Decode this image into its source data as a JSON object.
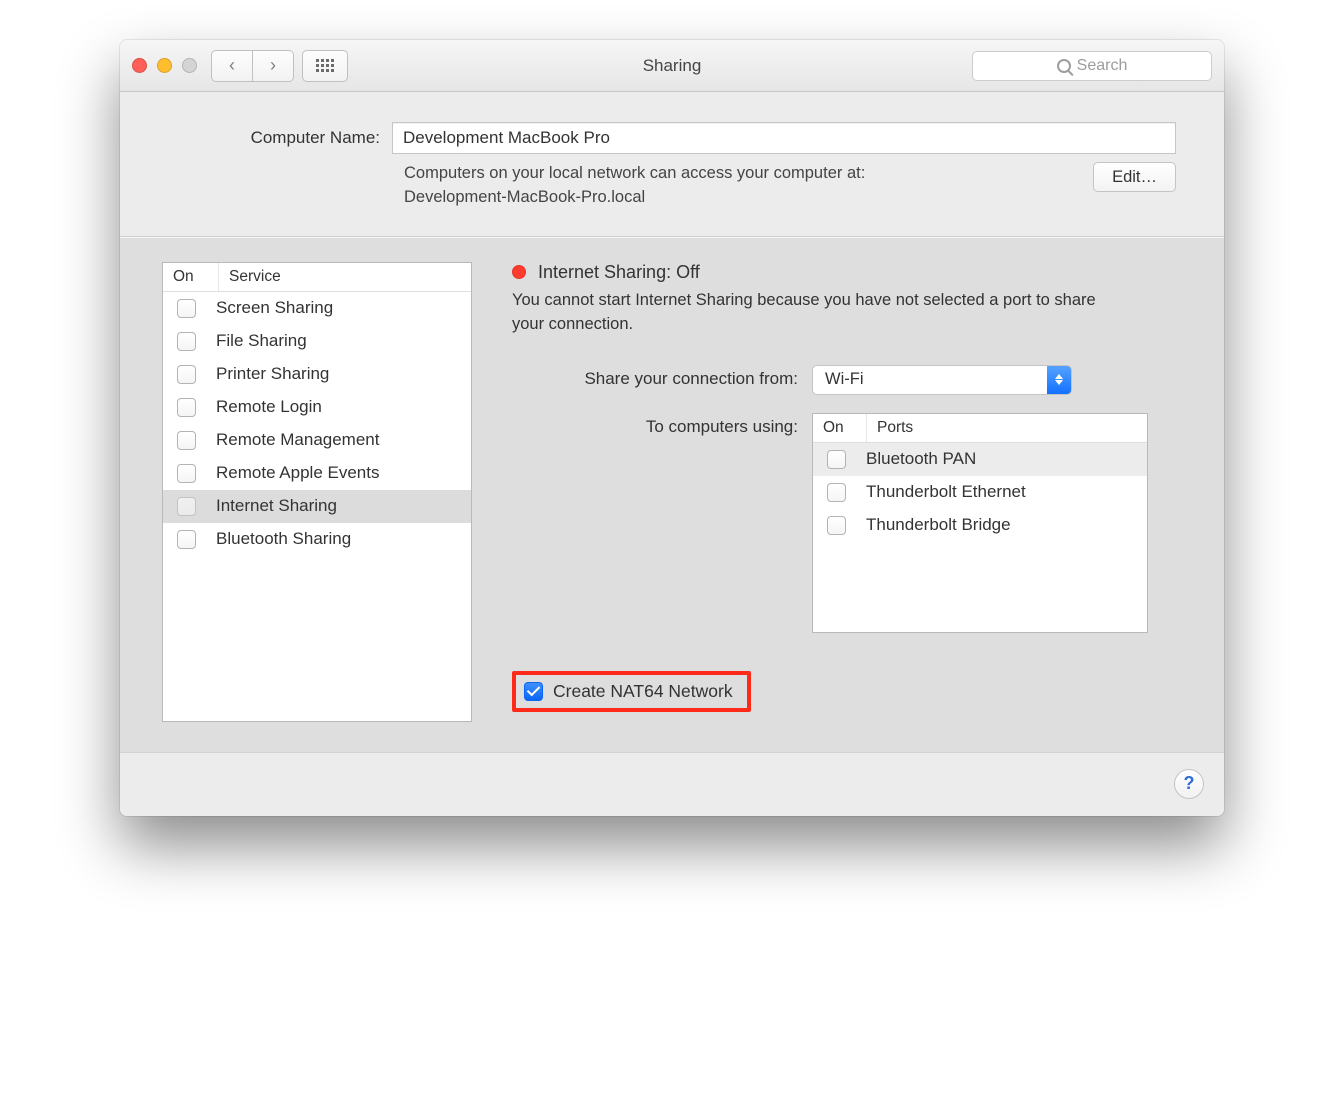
{
  "window": {
    "title": "Sharing"
  },
  "search": {
    "placeholder": "Search"
  },
  "computer_name": {
    "label": "Computer Name:",
    "value": "Development MacBook Pro",
    "subtext_line1": "Computers on your local network can access your computer at:",
    "subtext_line2": "Development-MacBook-Pro.local",
    "edit_label": "Edit…"
  },
  "services": {
    "col_on": "On",
    "col_service": "Service",
    "items": [
      {
        "label": "Screen Sharing"
      },
      {
        "label": "File Sharing"
      },
      {
        "label": "Printer Sharing"
      },
      {
        "label": "Remote Login"
      },
      {
        "label": "Remote Management"
      },
      {
        "label": "Remote Apple Events"
      },
      {
        "label": "Internet Sharing"
      },
      {
        "label": "Bluetooth Sharing"
      }
    ]
  },
  "detail": {
    "status_title": "Internet Sharing: Off",
    "status_desc": "You cannot start Internet Sharing because you have not selected a port to share your connection.",
    "share_from_label": "Share your connection from:",
    "share_from_value": "Wi-Fi",
    "to_computers_label": "To computers using:",
    "ports_col_on": "On",
    "ports_col_ports": "Ports",
    "ports": [
      {
        "label": "Bluetooth PAN"
      },
      {
        "label": "Thunderbolt Ethernet"
      },
      {
        "label": "Thunderbolt Bridge"
      }
    ],
    "nat64_label": "Create NAT64 Network"
  }
}
